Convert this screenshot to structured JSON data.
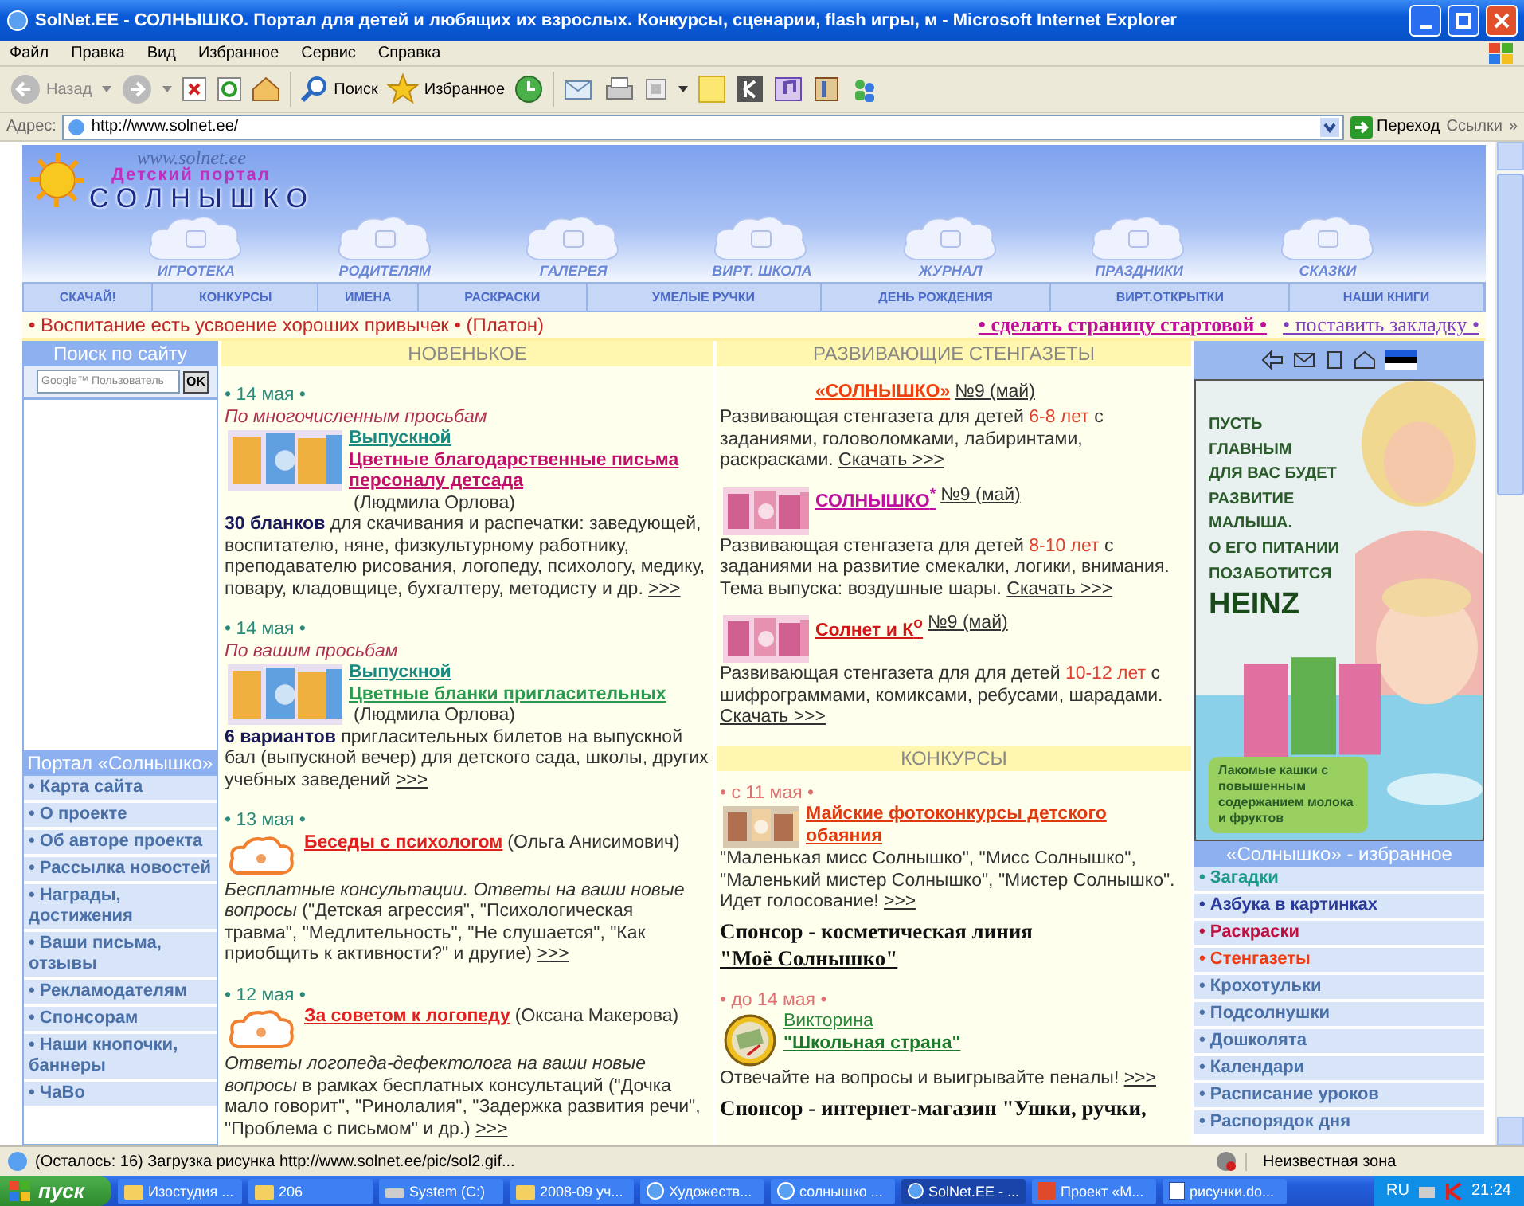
{
  "window": {
    "title": "SolNet.EE - СОЛНЫШКО. Портал для детей и любящих их взрослых. Конкурсы, сценарии, flash игры, м - Microsoft Internet Explorer"
  },
  "menu": [
    "Файл",
    "Правка",
    "Вид",
    "Избранное",
    "Сервис",
    "Справка"
  ],
  "toolbar": {
    "back": "Назад",
    "search": "Поиск",
    "favorites": "Избранное"
  },
  "address": {
    "label": "Адрес:",
    "value": "http://www.solnet.ee/",
    "go": "Переход",
    "links": "Ссылки",
    "more": "»"
  },
  "site": {
    "logo": {
      "url": "www.solnet.ee",
      "tagline": "Детский портал",
      "name": "СОЛНЫШКО"
    },
    "sections": [
      "ИГРОТЕКА",
      "РОДИТЕЛЯМ",
      "ГАЛЕРЕЯ",
      "ВИРТ. ШКОЛА",
      "ЖУРНАЛ",
      "ПРАЗДНИКИ",
      "СКАЗКИ"
    ],
    "nav": [
      "СКАЧАЙ!",
      "КОНКУРСЫ",
      "ИМЕНА",
      "РАСКРАСКИ",
      "УМЕЛЫЕ РУЧКИ",
      "ДЕНЬ РОЖДЕНИЯ",
      "ВИРТ.ОТКРЫТКИ",
      "НАШИ КНИГИ"
    ],
    "quote": "• Воспитание есть усвоение хороших привычек • (Платон)",
    "actions": [
      "• сделать страницу стартовой •",
      "• поставить закладку •"
    ]
  },
  "search": {
    "title": "Поиск по сайту",
    "placeholder": "Google™ Пользователь",
    "button": "OK"
  },
  "portal": {
    "title": "Портал «Солнышко»",
    "items": [
      "• Карта сайта",
      "• О проекте",
      "• Об авторе проекта",
      "• Рассылка новостей",
      "• Награды, достижения",
      "• Ваши письма, отзывы",
      "• Рекламодателям",
      "• Спонсорам",
      "• Наши кнопочки, баннеры",
      "• ЧаВо"
    ]
  },
  "news": {
    "title": "НОВЕНЬКОЕ",
    "items": [
      {
        "date": "• 14 мая •",
        "note": "По многочисленным просьбам",
        "kind": "picture",
        "links": [
          {
            "text": "Выпускной",
            "color": "#1a8a80"
          },
          {
            "text": "Цветные благодарственные письма персоналу детсада",
            "color": "#c0106a"
          }
        ],
        "author": "(Людмила Орлова)",
        "body": "**30 бланков** для скачивания и распечатки: заведующей, воспитателю, няне, физкультурному работнику, преподавателю рисования, логопеду, психологу, медику, повару, кладовщице, бухгалтеру, методисту и др.",
        "more": ">>>"
      },
      {
        "date": "• 14 мая •",
        "note": "По вашим просьбам",
        "kind": "picture",
        "links": [
          {
            "text": "Выпускной",
            "color": "#1a8a80"
          },
          {
            "text": "Цветные бланки пригласительных",
            "color": "#2a9a50"
          }
        ],
        "author": "(Людмила Орлова)",
        "body": "**6 вариантов** пригласительных билетов на выпускной бал (выпускной вечер) для детского сада, школы, других учебных заведений",
        "more": ">>>"
      },
      {
        "date": "• 13 мая •",
        "kind": "cloud",
        "links": [
          {
            "text": "Беседы с психологом",
            "color": "#e02020"
          }
        ],
        "author": "(Ольга Анисимович)",
        "body": "*Бесплатные консультации. Ответы на ваши новые вопросы* (\"Детская агрессия\", \"Психологическая травма\", \"Медлительность\", \"Не слушается\", \"Как приобщить к активности?\" и другие)",
        "more": ">>>"
      },
      {
        "date": "• 12 мая •",
        "kind": "cloud",
        "links": [
          {
            "text": "За советом к логопеду",
            "color": "#e02020"
          }
        ],
        "author": "(Оксана Макерова)",
        "body": "*Ответы логопеда-дефектолога на ваши новые вопросы* в рамках бесплатных консультаций (\"Дочка мало говорит\", \"Ринолалия\", \"Задержка развития речи\", \"Проблема с письмом\" и др.)",
        "more": ">>>"
      }
    ]
  },
  "papers": {
    "title": "РАЗВИВАЮЩИЕ СТЕНГАЗЕТЫ",
    "items": [
      {
        "thumb": false,
        "title": "«СОЛНЫШКО»",
        "color": "#f04010",
        "issue": "№9 (май)",
        "before": "Развивающая стенгазета для детей ",
        "age": "6-8 лет",
        "after": " с заданиями, головоломками, лабиринтами, раскрасками.",
        "download": "Скачать >>>"
      },
      {
        "thumb": true,
        "title": "СОЛНЫШКО$^{*}$",
        "color": "#c010a0",
        "issue": "№9 (май)",
        "before": "Развивающая стенгазета для детей ",
        "age": "8-10 лет",
        "after": " с заданиями на развитие смекалки, логики, внимания. Тема выпуска: воздушные шары.",
        "download": "Скачать >>>"
      },
      {
        "thumb": true,
        "title": "Солнет и К$^{о}$",
        "color": "#d01818",
        "issue": "№9 (май)",
        "before": "Развивающая стенгазета для для детей ",
        "age": "10-12 лет",
        "after": " с шифрограммами, комиксами, ребусами, шарадами.",
        "download": "Скачать >>>"
      }
    ]
  },
  "contests": {
    "title": "КОНКУРСЫ",
    "items": [
      {
        "date": "• с 11 мая •",
        "title": "Майские фотоконкурсы детского обаяния",
        "color": "#e03a10",
        "body": "\"Маленькая мисс Солнышко\", \"Мисс Солнышко\", \"Маленький мистер Солнышко\", \"Мистер Солнышко\". Идет голосование!",
        "more": ">>>",
        "sponsor": "Спонсор - косметическая линия",
        "sponsor_link": "\"Моё Солнышко\""
      },
      {
        "date": "• до 14 мая •",
        "kind": "medal",
        "category": "Викторина",
        "title": "\"Школьная страна\"",
        "color": "#1a7a2a",
        "body": "Отвечайте на вопросы и выигрывайте пеналы!",
        "more": ">>>",
        "sponsor": "Спонсор - интернет-магазин \"Ушки, ручки,"
      }
    ]
  },
  "ad": {
    "lines": [
      "ПУСТЬ",
      "ГЛАВНЫМ",
      "ДЛЯ ВАС БУДЕТ",
      "РАЗВИТИЕ",
      "МАЛЫША.",
      "О ЕГО ПИТАНИИ",
      "ПОЗАБОТИТСЯ"
    ],
    "brand": "HEINZ",
    "caption": "Лакомые кашки с повышенным содержанием молока и фруктов"
  },
  "favorites": {
    "title": "«Солнышко» - избранное",
    "items": [
      {
        "label": "• Загадки",
        "color": "#1a9a8a"
      },
      {
        "label": "• Азбука в картинках",
        "color": "#2a3a9a"
      },
      {
        "label": "• Раскраски",
        "color": "#c01040"
      },
      {
        "label": "• Стенгазеты",
        "color": "#f03a10"
      },
      {
        "label": "• Крохотульки",
        "color": "#4a70a8"
      },
      {
        "label": "• Подсолнушки",
        "color": "#4a70a8"
      },
      {
        "label": "• Дошколята",
        "color": "#4a70a8"
      },
      {
        "label": "• Календари",
        "color": "#4a70a8"
      },
      {
        "label": "• Расписание уроков",
        "color": "#4a70a8"
      },
      {
        "label": "• Распорядок дня",
        "color": "#4a70a8"
      }
    ]
  },
  "status": {
    "text": "(Осталось: 16) Загрузка рисунка http://www.solnet.ee/pic/sol2.gif...",
    "zone": "Неизвестная зона"
  },
  "taskbar": {
    "start": "пуск",
    "lang": "RU",
    "clock": "21:24",
    "tasks": [
      {
        "label": "Изостудия ...",
        "kind": "folder",
        "selected": false
      },
      {
        "label": "206",
        "kind": "folder",
        "selected": false
      },
      {
        "label": "System (C:)",
        "kind": "drive",
        "selected": false
      },
      {
        "label": "2008-09 уч...",
        "kind": "folder",
        "selected": false
      },
      {
        "label": "Художеств...",
        "kind": "browser",
        "selected": false
      },
      {
        "label": "солнышко ...",
        "kind": "browser",
        "selected": false
      },
      {
        "label": "SolNet.EE - ...",
        "kind": "browser",
        "selected": true
      },
      {
        "label": "Проект «М...",
        "kind": "slides",
        "selected": false
      },
      {
        "label": "рисунки.do...",
        "kind": "document",
        "selected": false
      }
    ]
  }
}
